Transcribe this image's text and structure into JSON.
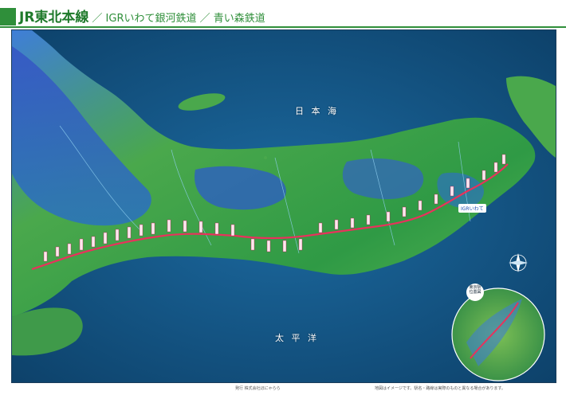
{
  "header": {
    "title_main": "JR東北本線",
    "title_sub": "／ IGRいわて銀河鉄道 ／ 青い森鉄道"
  },
  "map": {
    "sea_north": "日 本 海",
    "sea_south": "太 平 洋",
    "railway_label": "IGRいわて",
    "inset_badge": "東京駅\n位置図",
    "colors": {
      "sea": "#0f4c77",
      "land_low": "#2e9e4a",
      "land_mid": "#4aa84c",
      "mountain": "#2a53b8",
      "rail": "#e8325c"
    }
  },
  "footer": {
    "publisher": "発行 株式会社ほにゃらら",
    "notes": "地図はイメージです。駅名・路線は実際のものと異なる場合があります。"
  }
}
